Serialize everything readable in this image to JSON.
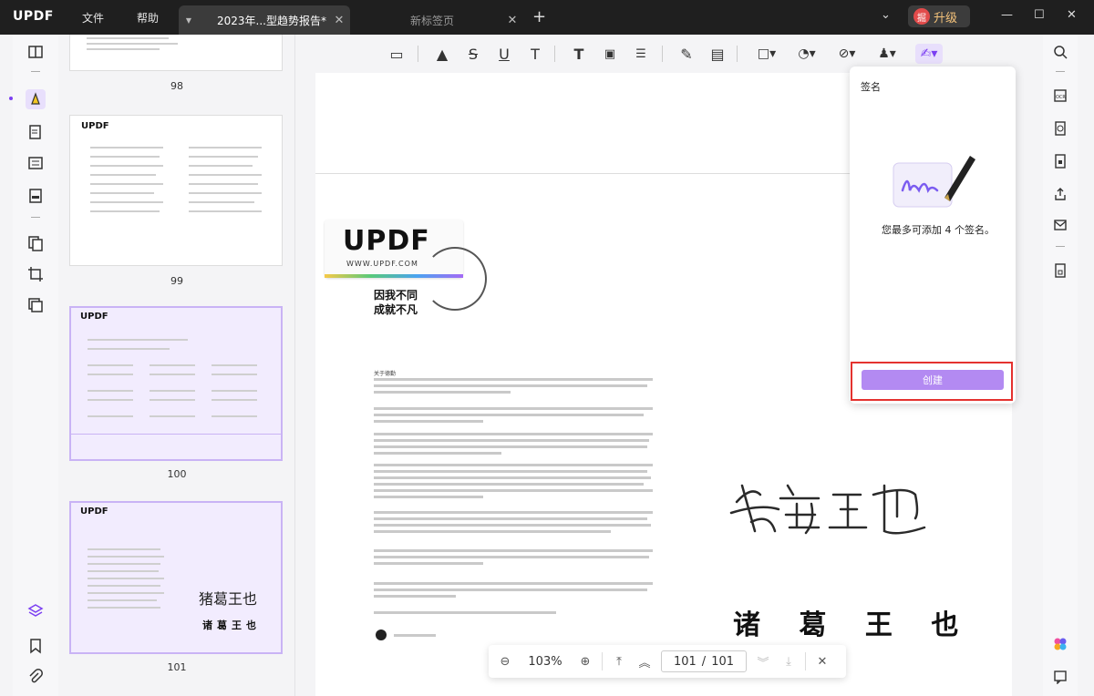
{
  "app": {
    "logo": "UPDF",
    "menu": [
      "文件",
      "帮助"
    ],
    "tabs": [
      {
        "label": "2023年...型趋势报告*",
        "active": true
      },
      {
        "label": "新标签页",
        "active": false
      }
    ],
    "upgrade_label": "升级",
    "upgrade_badge": "掘"
  },
  "thumbnails": [
    {
      "page": "98"
    },
    {
      "page": "99"
    },
    {
      "page": "100",
      "selected": true
    },
    {
      "page": "101",
      "selected": true
    }
  ],
  "document": {
    "brand": "UPDF",
    "brand_url": "WWW.UPDF.COM",
    "tagline_1": "因我不同",
    "tagline_2": "成就不凡",
    "about_heading": "关于德勤",
    "printed_signature": "诸 葛 王 也"
  },
  "navigation": {
    "zoom": "103%",
    "current_page": "101",
    "separator": "/",
    "total_pages": "101"
  },
  "signature_panel": {
    "title": "签名",
    "hint": "您最多可添加 4 个签名。",
    "create_label": "创建"
  },
  "colors": {
    "accent": "#b38af2",
    "highlight_box": "#e4322f",
    "titlebar": "#1f1f1f"
  }
}
